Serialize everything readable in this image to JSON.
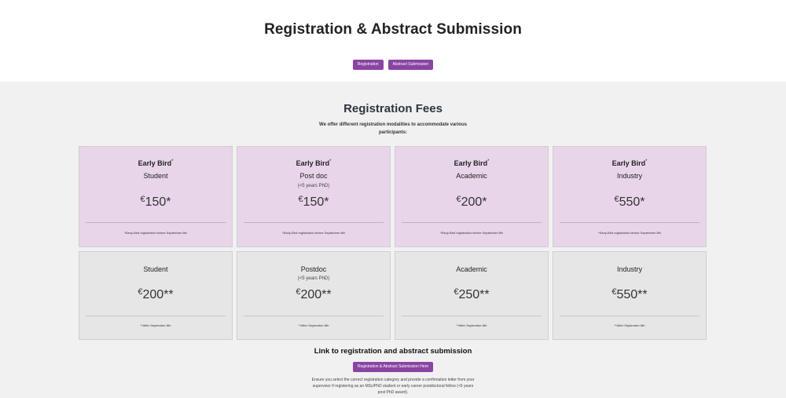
{
  "header": {
    "title": "Registration & Abstract Submission",
    "buttons": [
      {
        "label": "Registration"
      },
      {
        "label": "Abstract Submission"
      }
    ]
  },
  "fees": {
    "title": "Registration Fees",
    "intro": "We offer different registration modalities to accommodate various participants:",
    "currency_symbol": "€",
    "early_bird": {
      "tier_label": "Early Bird",
      "tier_mark": "*",
      "note": "*Early-Bird registration before September 8th",
      "cards": [
        {
          "category": "Student",
          "subtext": "",
          "price": "150*"
        },
        {
          "category": "Post doc",
          "subtext": "(<5 years PhD)",
          "price": "150*"
        },
        {
          "category": "Academic",
          "subtext": "",
          "price": "200*"
        },
        {
          "category": "Industry",
          "subtext": "",
          "price": "550*"
        }
      ]
    },
    "regular": {
      "note": "**After September 8th",
      "cards": [
        {
          "category": "Student",
          "subtext": "",
          "price": "200**"
        },
        {
          "category": "Postdoc",
          "subtext": "(<5 years PhD)",
          "price": "200**"
        },
        {
          "category": "Academic",
          "subtext": "",
          "price": "250**"
        },
        {
          "category": "Industry",
          "subtext": "",
          "price": "550**"
        }
      ]
    }
  },
  "link_section": {
    "heading": "Link to registration and abstract submission",
    "button_label": "Registration & Abstract Submission Here",
    "footnote": "Ensure you select the correct registration category and provide a confirmation letter from your supervisor if registering as an MSc/PhD student or early career postdoctoral fellow (<5 years post PhD award)."
  },
  "colors": {
    "accent": "#8a44a3",
    "early_bird_card": "#e9d5ea",
    "regular_card": "#e6e6e6",
    "section_bg": "#f1f1f1"
  }
}
